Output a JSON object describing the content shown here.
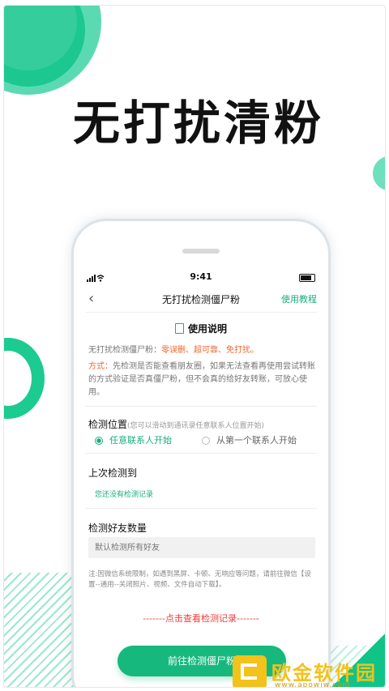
{
  "headline": "无打扰清粉",
  "status_bar": {
    "time": "9:41"
  },
  "nav": {
    "title": "无打扰检测僵尸粉",
    "help": "使用教程"
  },
  "guide": {
    "title": "使用说明",
    "desc_prefix": "无打扰检测僵尸粉：",
    "desc_highlight": "零误删、超可靠、免打扰。",
    "method_tag": "方式：",
    "method_text": "先检测是否能查看朋友圈，如果无法查看再使用尝试转账的方式验证是否真僵尸粉，但不会真的给好友转账，可放心使用。"
  },
  "location": {
    "label": "检测位置",
    "hint": "(您可以滑动到通讯录任意联系人位置开始)",
    "options": [
      {
        "label": "任意联系人开始",
        "selected": true
      },
      {
        "label": "从第一个联系人开始",
        "selected": false
      }
    ]
  },
  "last_check": {
    "label": "上次检测到",
    "value": "您还没有检测记录"
  },
  "friend_count": {
    "label": "检测好友数量",
    "placeholder": "默认检测所有好友"
  },
  "note": "注:因微信系统限制，如遇到黑屏、卡顿、无响应等问题，请前往微信【设置--通用--关闭照片、视频、文件自动下载】。",
  "record_link": "-------点击查看检测记录-------",
  "primary_button": "前往检测僵尸粉",
  "watermark": {
    "text": "欧金软件园",
    "url": "www.apowjw.com"
  },
  "colors": {
    "accent": "#17b87e",
    "highlight": "#f0662b",
    "link_red": "#f03b3b"
  }
}
